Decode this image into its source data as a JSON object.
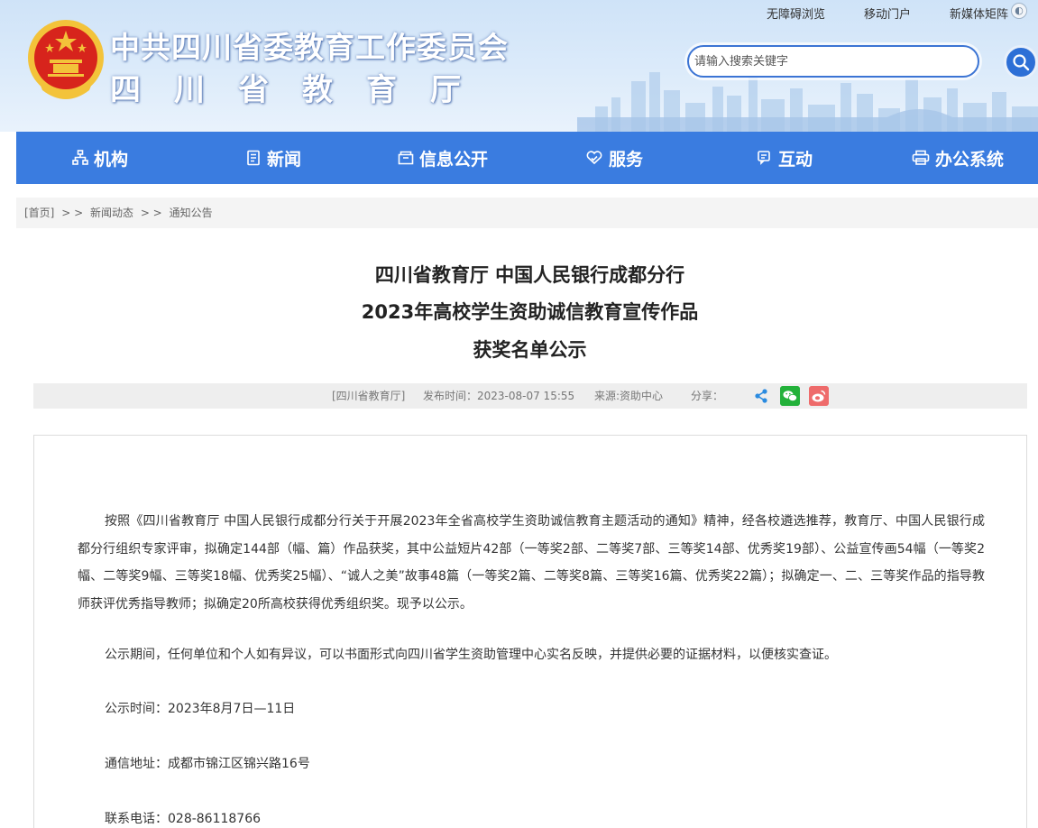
{
  "header": {
    "title_line1": "中共四川省委教育工作委员会",
    "title_line2": "四川省教育厅",
    "top_links": [
      "无障碍浏览",
      "移动门户",
      "新媒体矩阵"
    ],
    "search": {
      "placeholder": "请输入搜索关键字"
    }
  },
  "nav": {
    "items": [
      {
        "label": "机构",
        "icon": "org-chart-icon"
      },
      {
        "label": "新闻",
        "icon": "news-icon"
      },
      {
        "label": "信息公开",
        "icon": "folder-icon"
      },
      {
        "label": "服务",
        "icon": "heart-hand-icon"
      },
      {
        "label": "互动",
        "icon": "chat-icon"
      },
      {
        "label": "办公系统",
        "icon": "printer-icon"
      }
    ]
  },
  "breadcrumb": {
    "home": "[首页]",
    "sep": "> >",
    "level1": "新闻动态",
    "level2": "通知公告"
  },
  "article": {
    "title_lines": [
      "四川省教育厅 中国人民银行成都分行",
      "2023年高校学生资助诚信教育宣传作品",
      "获奖名单公示"
    ],
    "meta": {
      "site": "[四川省教育厅]",
      "published": "发布时间：2023-08-07 15:55",
      "source": "来源:资助中心",
      "share_label": "分享："
    },
    "paragraphs": [
      "按照《四川省教育厅 中国人民银行成都分行关于开展2023年全省高校学生资助诚信教育主题活动的通知》精神，经各校遴选推荐，教育厅、中国人民银行成都分行组织专家评审，拟确定144部（幅、篇）作品获奖，其中公益短片42部（一等奖2部、二等奖7部、三等奖14部、优秀奖19部）、公益宣传画54幅（一等奖2幅、二等奖9幅、三等奖18幅、优秀奖25幅）、“诚人之美”故事48篇（一等奖2篇、二等奖8篇、三等奖16篇、优秀奖22篇）；拟确定一、二、三等奖作品的指导教师获评优秀指导教师；拟确定20所高校获得优秀组织奖。现予以公示。",
      "公示期间，任何单位和个人如有异议，可以书面形式向四川省学生资助管理中心实名反映，并提供必要的证据材料，以便核实查证。",
      "公示时间：2023年8月7日—11日",
      "通信地址：成都市锦江区锦兴路16号",
      "联系电话：028-86118766"
    ]
  },
  "colors": {
    "nav_blue": "#3a7ce0",
    "search_blue": "#2d6fd6",
    "emblem_red": "#d7241c",
    "emblem_gold": "#f3c33a",
    "wechat_green": "#23b13a",
    "weibo_red": "#ee6b6b"
  }
}
